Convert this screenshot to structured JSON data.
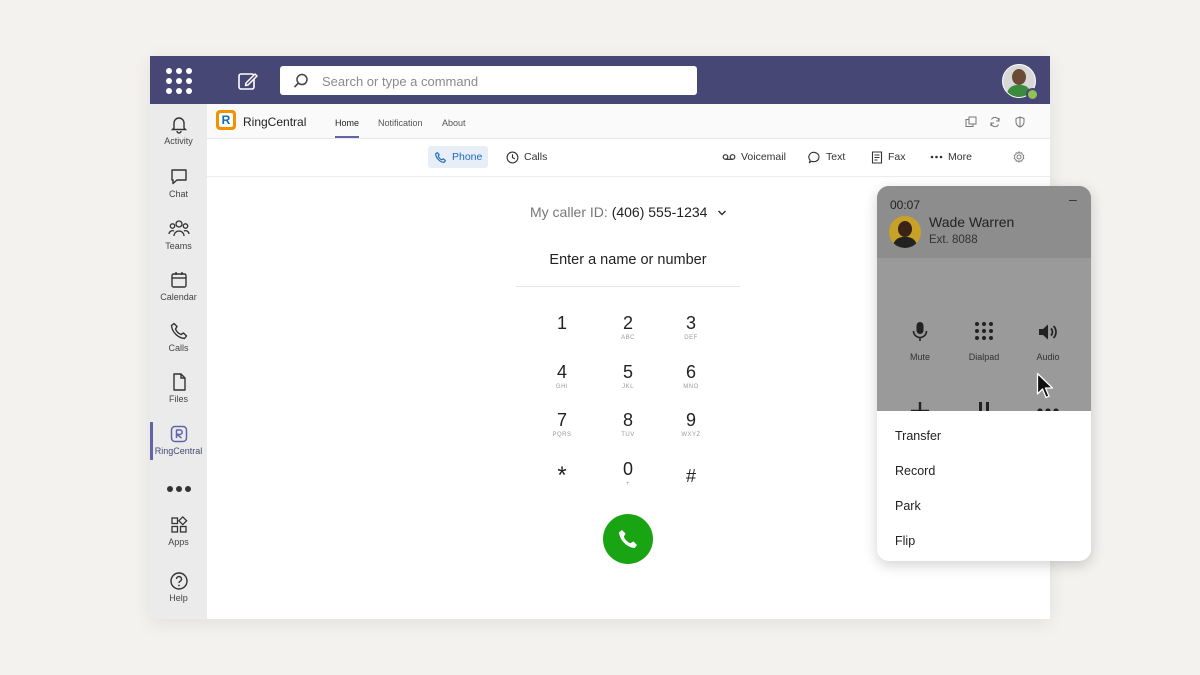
{
  "search": {
    "placeholder": "Search or type a command"
  },
  "rail": {
    "items": [
      {
        "label": "Activity",
        "icon": "bell-icon"
      },
      {
        "label": "Chat",
        "icon": "chat-icon"
      },
      {
        "label": "Teams",
        "icon": "teams-icon"
      },
      {
        "label": "Calendar",
        "icon": "calendar-icon"
      },
      {
        "label": "Calls",
        "icon": "phone-icon"
      },
      {
        "label": "Files",
        "icon": "file-icon"
      },
      {
        "label": "RingCentral",
        "icon": "ringcentral-icon",
        "active": true
      },
      {
        "label": "Apps",
        "icon": "apps-icon"
      },
      {
        "label": "Help",
        "icon": "help-icon"
      }
    ]
  },
  "app": {
    "name": "RingCentral",
    "tabs": [
      "Home",
      "Notification",
      "About"
    ],
    "active_tab": "Home"
  },
  "subnav": {
    "tabs": [
      {
        "label": "Phone",
        "icon": "phone-icon",
        "active": true
      },
      {
        "label": "Calls",
        "icon": "clock-icon"
      },
      {
        "label": "Voicemail",
        "icon": "voicemail-icon"
      },
      {
        "label": "Text",
        "icon": "message-icon"
      },
      {
        "label": "Fax",
        "icon": "fax-icon"
      },
      {
        "label": "More",
        "icon": "more-dots-icon"
      }
    ]
  },
  "dialer": {
    "caller_id_label": "My caller ID:",
    "caller_id_value": "(406) 555-1234",
    "placeholder": "Enter a name or number",
    "keys": [
      {
        "num": "1",
        "letters": ""
      },
      {
        "num": "2",
        "letters": "ABC"
      },
      {
        "num": "3",
        "letters": "DEF"
      },
      {
        "num": "4",
        "letters": "GHI"
      },
      {
        "num": "5",
        "letters": "JKL"
      },
      {
        "num": "6",
        "letters": "MNO"
      },
      {
        "num": "7",
        "letters": "PQRS"
      },
      {
        "num": "8",
        "letters": "TUV"
      },
      {
        "num": "9",
        "letters": "WXYZ"
      },
      {
        "num": "*",
        "letters": ""
      },
      {
        "num": "0",
        "letters": "+"
      },
      {
        "num": "#",
        "letters": ""
      }
    ]
  },
  "call_popup": {
    "timer": "00:07",
    "minimize": "–",
    "caller_name": "Wade Warren",
    "caller_ext": "Ext. 8088",
    "controls": [
      {
        "label": "Mute",
        "icon": "microphone-icon"
      },
      {
        "label": "Dialpad",
        "icon": "dialpad-icon"
      },
      {
        "label": "Audio",
        "icon": "speaker-icon"
      }
    ],
    "menu": [
      "Transfer",
      "Record",
      "Park",
      "Flip"
    ]
  },
  "colors": {
    "topbar": "#464775",
    "accent": "#6264a7",
    "call_green": "#18a413",
    "ringcentral_orange": "#f39200",
    "active_tab_blue": "#1c6aba"
  }
}
